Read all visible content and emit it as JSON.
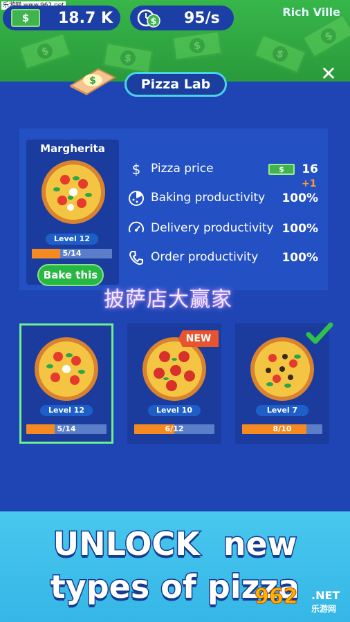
{
  "watermark_top": "乐游网 www.962.net",
  "header": {
    "money_value": "18.7 K",
    "rate_value": "95/s",
    "city_name": "Rich Ville",
    "money_icon": "dollar-bill-icon",
    "rate_icon": "clock-dollar-icon"
  },
  "title": {
    "label": "Pizza Lab",
    "close_symbol": "✕"
  },
  "selected_pizza": {
    "name": "Margherita",
    "level_label": "Level 12",
    "progress_text": "5/14",
    "progress_fraction": 0.357,
    "bake_button_label": "Bake this"
  },
  "stats": {
    "price_label": "Pizza price",
    "price_value": "16",
    "price_delta": "+1",
    "baking_label": "Baking productivity",
    "baking_value": "100%",
    "delivery_label": "Delivery productivity",
    "delivery_value": "100%",
    "order_label": "Order productivity",
    "order_value": "100%"
  },
  "overlay_text": "披萨店大赢家",
  "cards": [
    {
      "level_label": "Level 12",
      "progress_text": "5/14",
      "progress_fraction": 0.357,
      "selected": true,
      "badge": ""
    },
    {
      "level_label": "Level 10",
      "progress_text": "6/12",
      "progress_fraction": 0.5,
      "selected": false,
      "badge": "NEW"
    },
    {
      "level_label": "Level 7",
      "progress_text": "8/10",
      "progress_fraction": 0.8,
      "selected": false,
      "badge": "check"
    }
  ],
  "banner": {
    "line1_word1": "UNLOCK",
    "line1_word2": "new",
    "line2": "types of pizza"
  },
  "watermark_logo": {
    "big": "962",
    "net": ".NET",
    "cn": "乐游网"
  },
  "colors": {
    "background": "#1f45b4",
    "accent_green": "#27b743",
    "progress_orange": "#f58a22",
    "title_border": "#4ad4e8",
    "bottom_banner": "#48c8ee"
  }
}
